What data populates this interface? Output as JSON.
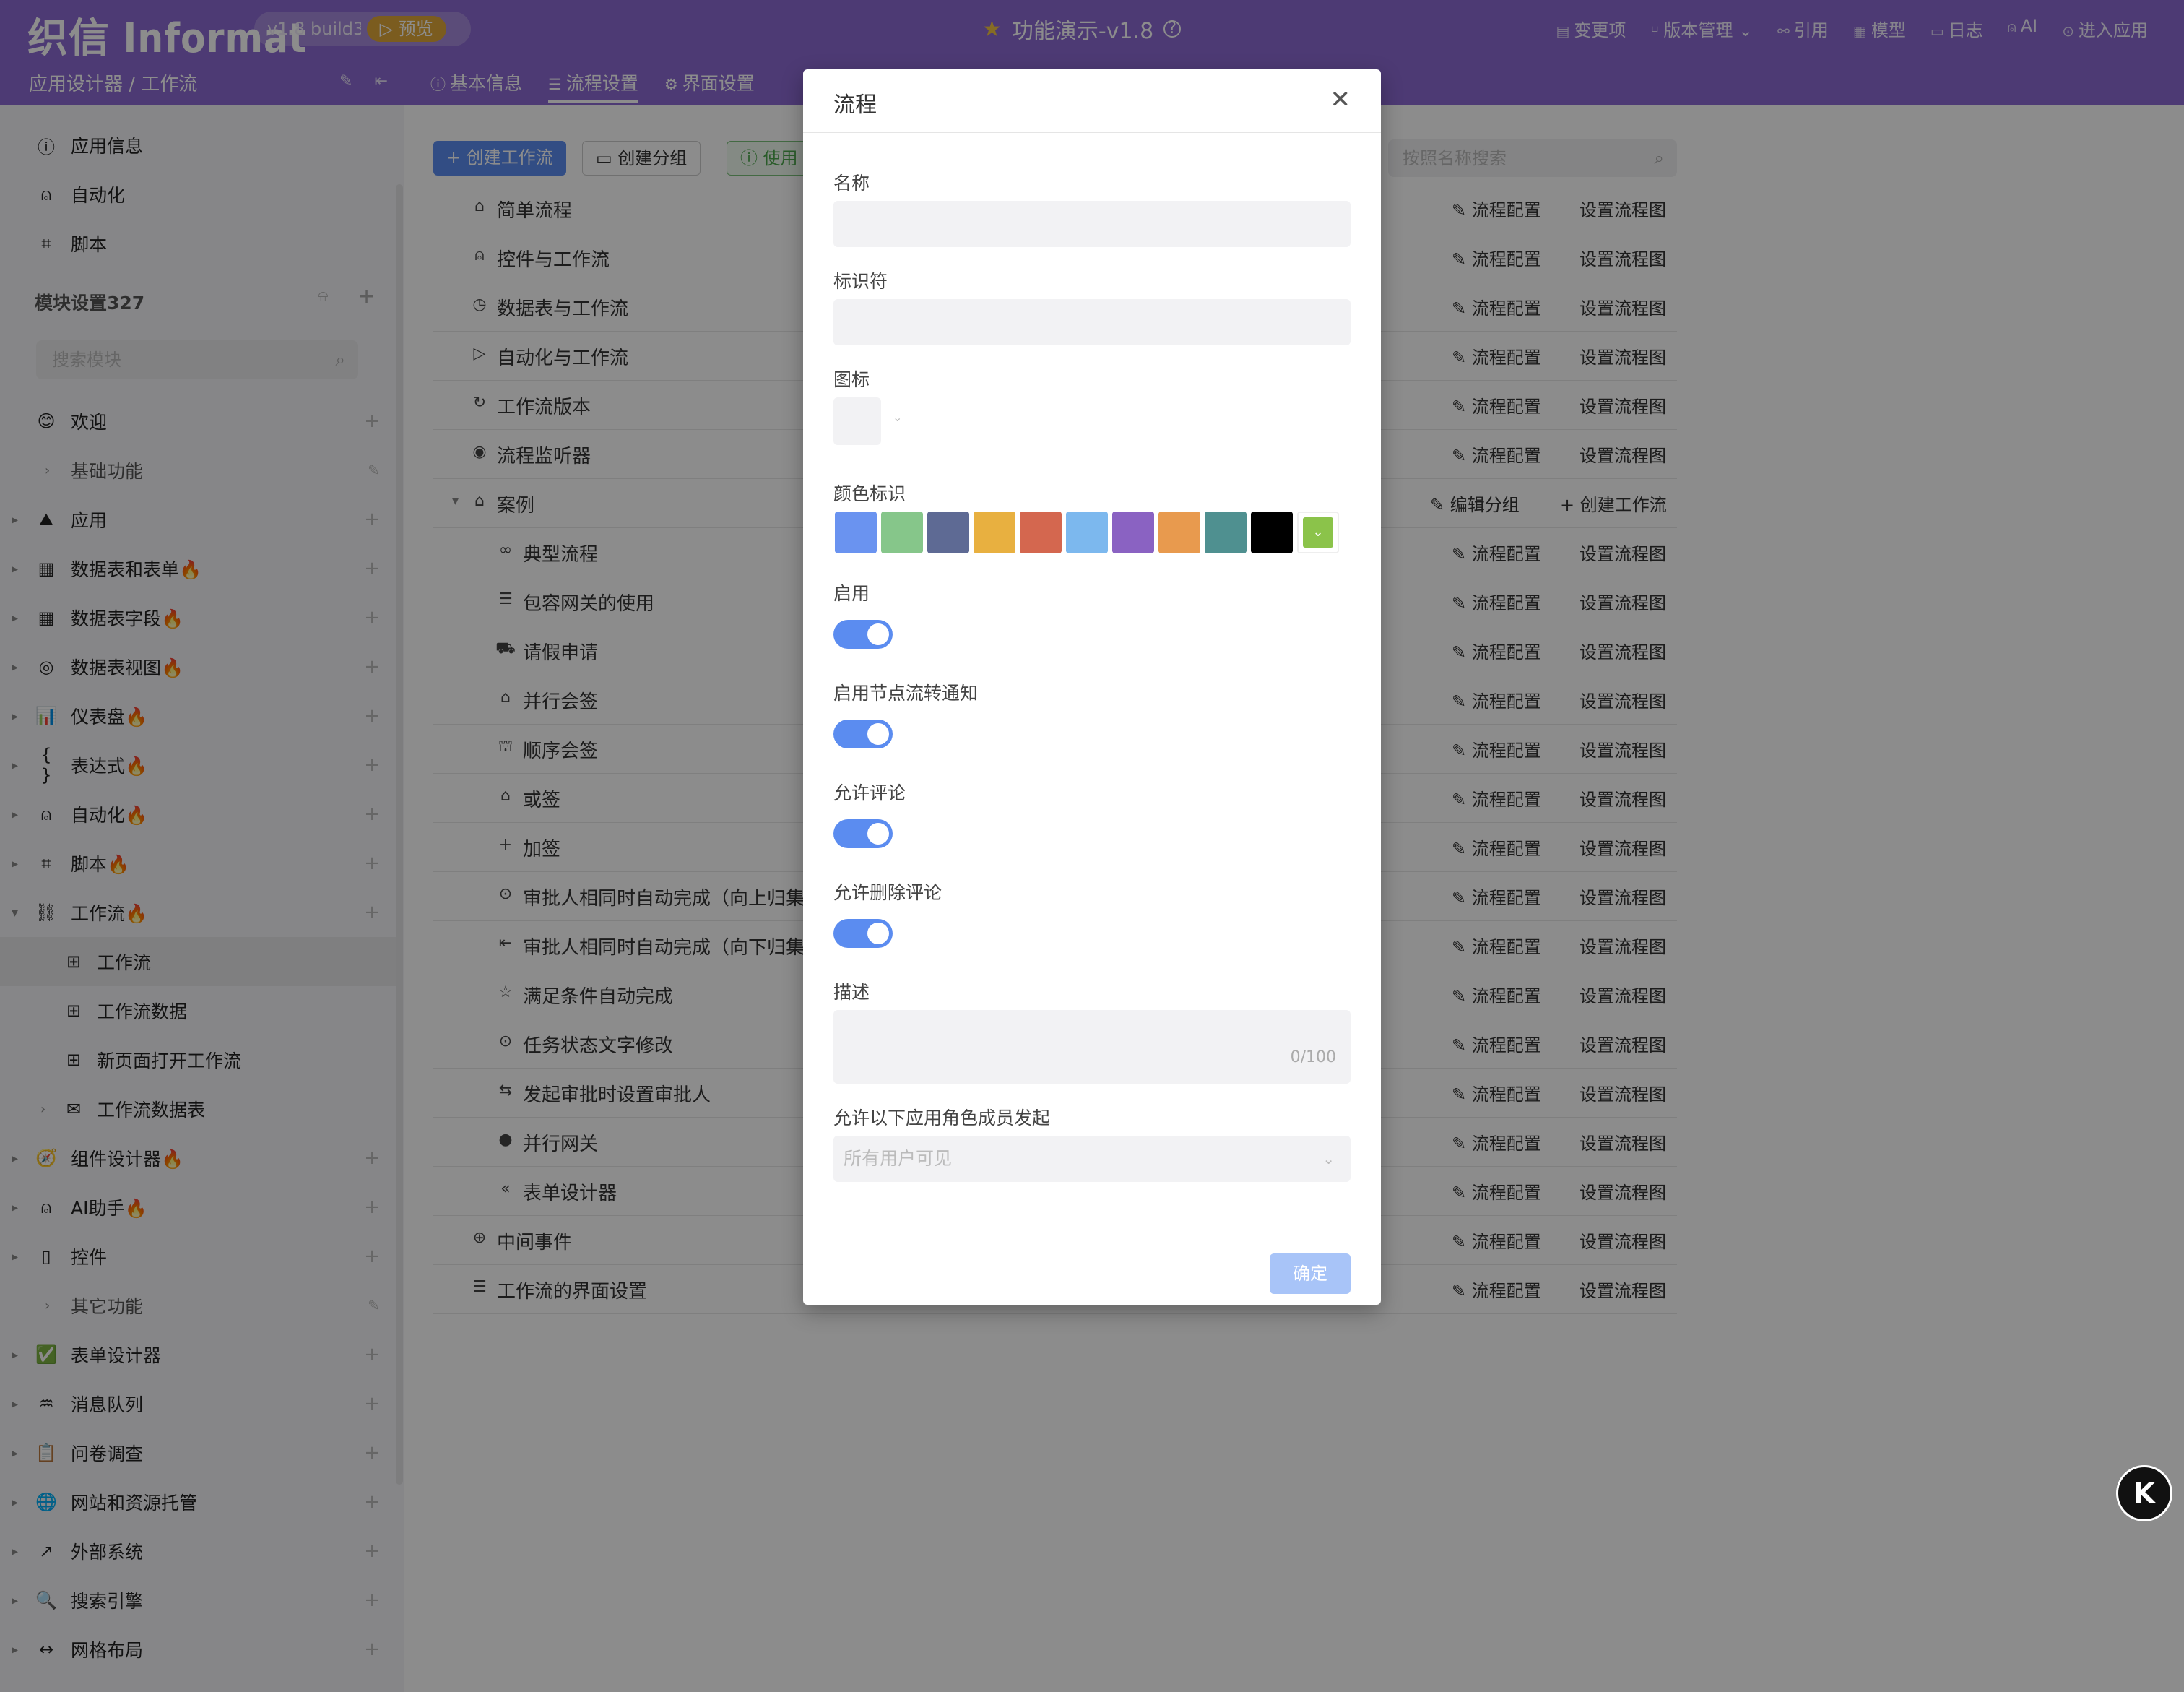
{
  "header": {
    "logo": "织信 Informat",
    "version": "v1.8 build37(",
    "preview": "▷ 预览",
    "title": "功能演示-v1.8",
    "nav": [
      {
        "icon": "list-icon",
        "label": "变更项"
      },
      {
        "icon": "branch-icon",
        "label": "版本管理 ⌄"
      },
      {
        "icon": "link-icon",
        "label": "引用"
      },
      {
        "icon": "table-icon",
        "label": "模型"
      },
      {
        "icon": "log-icon",
        "label": "日志"
      },
      {
        "icon": "robot-icon",
        "label": "AI"
      },
      {
        "icon": "enter-icon",
        "label": "进入应用"
      }
    ],
    "breadcrumb": "应用设计器 / 工作流",
    "tabs": [
      {
        "icon": "info-icon",
        "label": "基本信息",
        "active": false
      },
      {
        "icon": "flow-icon",
        "label": "流程设置",
        "active": true
      },
      {
        "icon": "gear-icon",
        "label": "界面设置",
        "active": false
      }
    ]
  },
  "sidebar": {
    "top_items": [
      {
        "icon": "info-icon",
        "label": "应用信息"
      },
      {
        "icon": "robot-icon",
        "label": "自动化"
      },
      {
        "icon": "script-icon",
        "label": "脚本"
      }
    ],
    "module_header": "模块设置327",
    "search_placeholder": "搜索模块",
    "items": [
      {
        "icon": "smile-icon",
        "label": "欢迎",
        "level": 0,
        "arrow": ""
      },
      {
        "icon": "",
        "label": "基础功能",
        "level": 0,
        "arrow": "›",
        "group": true
      },
      {
        "icon": "mountain-icon",
        "label": "应用",
        "level": 0,
        "arrow": "▸"
      },
      {
        "icon": "table-icon",
        "label": "数据表和表单🔥",
        "level": 0,
        "arrow": "▸"
      },
      {
        "icon": "grid-icon",
        "label": "数据表字段🔥",
        "level": 0,
        "arrow": "▸"
      },
      {
        "icon": "view-icon",
        "label": "数据表视图🔥",
        "level": 0,
        "arrow": "▸"
      },
      {
        "icon": "chart-icon",
        "label": "仪表盘🔥",
        "level": 0,
        "arrow": "▸"
      },
      {
        "icon": "braces-icon",
        "label": "表达式🔥",
        "level": 0,
        "arrow": "▸"
      },
      {
        "icon": "robot-icon",
        "label": "自动化🔥",
        "level": 0,
        "arrow": "▸"
      },
      {
        "icon": "script-icon",
        "label": "脚本🔥",
        "level": 0,
        "arrow": "▸"
      },
      {
        "icon": "workflow-icon",
        "label": "工作流🔥",
        "level": 0,
        "arrow": "▾"
      },
      {
        "icon": "workflow-small-icon",
        "label": "工作流",
        "level": 1,
        "arrow": "",
        "selected": true
      },
      {
        "icon": "workflow-small-icon",
        "label": "工作流数据",
        "level": 1,
        "arrow": ""
      },
      {
        "icon": "workflow-small-icon",
        "label": "新页面打开工作流",
        "level": 1,
        "arrow": ""
      },
      {
        "icon": "mail-icon",
        "label": "工作流数据表",
        "level": 1,
        "arrow": "›"
      },
      {
        "icon": "compass-icon",
        "label": "组件设计器🔥",
        "level": 0,
        "arrow": "▸"
      },
      {
        "icon": "robot-icon",
        "label": "AI助手🔥",
        "level": 0,
        "arrow": "▸"
      },
      {
        "icon": "control-icon",
        "label": "控件",
        "level": 0,
        "arrow": "▸"
      },
      {
        "icon": "",
        "label": "其它功能",
        "level": 0,
        "arrow": "›",
        "group": true
      },
      {
        "icon": "check-icon",
        "label": "表单设计器",
        "level": 0,
        "arrow": "▸"
      },
      {
        "icon": "queue-icon",
        "label": "消息队列",
        "level": 0,
        "arrow": "▸"
      },
      {
        "icon": "clipboard-icon",
        "label": "问卷调查",
        "level": 0,
        "arrow": "▸"
      },
      {
        "icon": "globe-icon",
        "label": "网站和资源托管",
        "level": 0,
        "arrow": "▸"
      },
      {
        "icon": "external-icon",
        "label": "外部系统",
        "level": 0,
        "arrow": "▸"
      },
      {
        "icon": "search-icon",
        "label": "搜索引擎",
        "level": 0,
        "arrow": "▸"
      },
      {
        "icon": "layout-icon",
        "label": "网格布局",
        "level": 0,
        "arrow": "▸"
      }
    ]
  },
  "toolbar": {
    "create_flow": "+ 创建工作流",
    "create_group": "创建分组",
    "use": "使用",
    "search_placeholder": "按照名称搜索"
  },
  "rows": [
    {
      "label": "简单流程",
      "level": 0,
      "icon": "⌂"
    },
    {
      "label": "控件与工作流",
      "level": 0,
      "icon": "⍝"
    },
    {
      "label": "数据表与工作流",
      "level": 0,
      "icon": "◷"
    },
    {
      "label": "自动化与工作流",
      "level": 0,
      "icon": "▷"
    },
    {
      "label": "工作流版本",
      "level": 0,
      "icon": "↻"
    },
    {
      "label": "流程监听器",
      "level": 0,
      "icon": "◉"
    },
    {
      "label": "案例",
      "level": 0,
      "icon": "⌂",
      "group": true
    },
    {
      "label": "典型流程",
      "level": 1,
      "icon": "∞"
    },
    {
      "label": "包容网关的使用",
      "level": 1,
      "icon": "☰"
    },
    {
      "label": "请假申请",
      "level": 1,
      "icon": "⛟"
    },
    {
      "label": "并行会签",
      "level": 1,
      "icon": "⌂"
    },
    {
      "label": "顺序会签",
      "level": 1,
      "icon": "⛫"
    },
    {
      "label": "或签",
      "level": 1,
      "icon": "⌂"
    },
    {
      "label": "加签",
      "level": 1,
      "icon": "+"
    },
    {
      "label": "审批人相同时自动完成（向上归集",
      "level": 1,
      "icon": "⊙"
    },
    {
      "label": "审批人相同时自动完成（向下归集",
      "level": 1,
      "icon": "⇤"
    },
    {
      "label": "满足条件自动完成",
      "level": 1,
      "icon": "☆"
    },
    {
      "label": "任务状态文字修改",
      "level": 1,
      "icon": "⊙"
    },
    {
      "label": "发起审批时设置审批人",
      "level": 1,
      "icon": "⇆"
    },
    {
      "label": "并行网关",
      "level": 1,
      "icon": "●"
    },
    {
      "label": "表单设计器",
      "level": 1,
      "icon": "«"
    },
    {
      "label": "中间事件",
      "level": 0,
      "icon": "⊕"
    },
    {
      "label": "工作流的界面设置",
      "level": 0,
      "icon": "☰"
    }
  ],
  "row_actions": {
    "config": "流程配置",
    "diagram": "设置流程图",
    "edit_group": "编辑分组",
    "create_flow": "创建工作流"
  },
  "dialog": {
    "title": "流程",
    "name_label": "名称",
    "name_value": "",
    "id_label": "标识符",
    "id_value": "",
    "icon_label": "图标",
    "color_label": "颜色标识",
    "colors": [
      "#6a93f0",
      "#86c68a",
      "#5e6a94",
      "#e8b040",
      "#d4674f",
      "#7cb8ee",
      "#8a62c2",
      "#e89a4e",
      "#4f9090",
      "#000000"
    ],
    "selected_color": "#8bc34a",
    "enable_label": "启用",
    "enable": true,
    "notify_label": "启用节点流转通知",
    "notify": true,
    "comment_label": "允许评论",
    "comment": true,
    "delete_comment_label": "允许删除评论",
    "delete_comment": true,
    "desc_label": "描述",
    "desc_counter": "0/100",
    "roles_label": "允许以下应用角色成员发起",
    "roles_placeholder": "所有用户可见",
    "ok": "确定"
  },
  "fab": "K"
}
